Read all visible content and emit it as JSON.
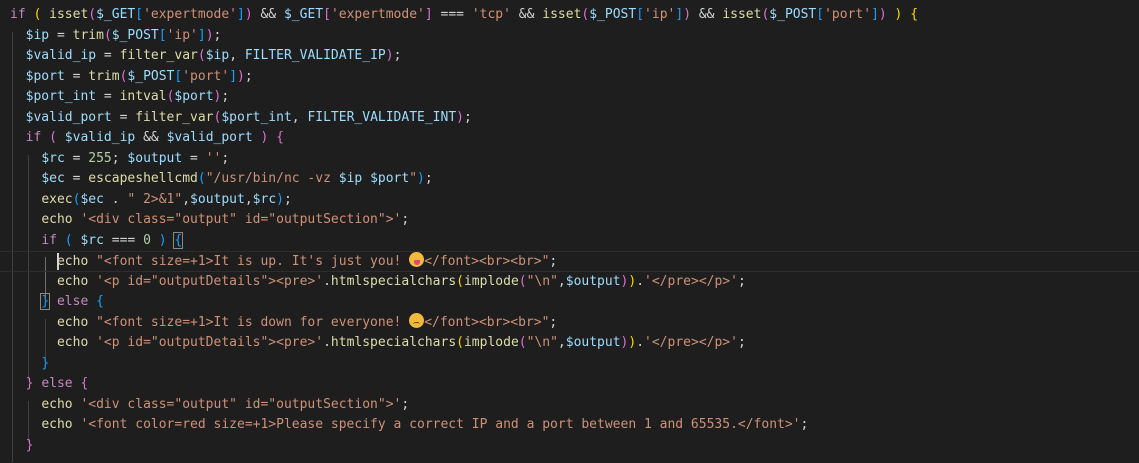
{
  "editor": {
    "language": "php",
    "theme": {
      "background": "#1e1e1e",
      "keyword": "#c586c0",
      "function": "#dcdcaa",
      "variable": "#9cdcfe",
      "string": "#ce9178",
      "number": "#b5cea8",
      "bracket_level1": "#ffd700",
      "bracket_level2": "#da70d6",
      "bracket_level3": "#179fff"
    },
    "current_line": 13,
    "lines": [
      [
        [
          "kw",
          "if"
        ],
        [
          "op",
          " "
        ],
        [
          "p1",
          "("
        ],
        [
          "op",
          " "
        ],
        [
          "fn",
          "isset"
        ],
        [
          "p2",
          "("
        ],
        [
          "var",
          "$_GET"
        ],
        [
          "p3",
          "["
        ],
        [
          "str",
          "'expertmode'"
        ],
        [
          "p3",
          "]"
        ],
        [
          "p2",
          ")"
        ],
        [
          "op",
          " && "
        ],
        [
          "var",
          "$_GET"
        ],
        [
          "p2",
          "["
        ],
        [
          "str",
          "'expertmode'"
        ],
        [
          "p2",
          "]"
        ],
        [
          "op",
          " === "
        ],
        [
          "str",
          "'tcp'"
        ],
        [
          "op",
          " && "
        ],
        [
          "fn",
          "isset"
        ],
        [
          "p2",
          "("
        ],
        [
          "var",
          "$_POST"
        ],
        [
          "p3",
          "["
        ],
        [
          "str",
          "'ip'"
        ],
        [
          "p3",
          "]"
        ],
        [
          "p2",
          ")"
        ],
        [
          "op",
          " && "
        ],
        [
          "fn",
          "isset"
        ],
        [
          "p2",
          "("
        ],
        [
          "var",
          "$_POST"
        ],
        [
          "p3",
          "["
        ],
        [
          "str",
          "'port'"
        ],
        [
          "p3",
          "]"
        ],
        [
          "p2",
          ")"
        ],
        [
          "op",
          " "
        ],
        [
          "p1",
          ")"
        ],
        [
          "op",
          " "
        ],
        [
          "p1",
          "{"
        ]
      ],
      [
        [
          "op",
          "  "
        ],
        [
          "var",
          "$ip"
        ],
        [
          "op",
          " = "
        ],
        [
          "fn",
          "trim"
        ],
        [
          "p2",
          "("
        ],
        [
          "var",
          "$_POST"
        ],
        [
          "p3",
          "["
        ],
        [
          "str",
          "'ip'"
        ],
        [
          "p3",
          "]"
        ],
        [
          "p2",
          ")"
        ],
        [
          "op",
          ";"
        ]
      ],
      [
        [
          "op",
          "  "
        ],
        [
          "var",
          "$valid_ip"
        ],
        [
          "op",
          " = "
        ],
        [
          "fn",
          "filter_var"
        ],
        [
          "p2",
          "("
        ],
        [
          "var",
          "$ip"
        ],
        [
          "op",
          ", "
        ],
        [
          "const",
          "FILTER_VALIDATE_IP"
        ],
        [
          "p2",
          ")"
        ],
        [
          "op",
          ";"
        ]
      ],
      [
        [
          "op",
          "  "
        ],
        [
          "var",
          "$port"
        ],
        [
          "op",
          " = "
        ],
        [
          "fn",
          "trim"
        ],
        [
          "p2",
          "("
        ],
        [
          "var",
          "$_POST"
        ],
        [
          "p3",
          "["
        ],
        [
          "str",
          "'port'"
        ],
        [
          "p3",
          "]"
        ],
        [
          "p2",
          ")"
        ],
        [
          "op",
          ";"
        ]
      ],
      [
        [
          "op",
          "  "
        ],
        [
          "var",
          "$port_int"
        ],
        [
          "op",
          " = "
        ],
        [
          "fn",
          "intval"
        ],
        [
          "p2",
          "("
        ],
        [
          "var",
          "$port"
        ],
        [
          "p2",
          ")"
        ],
        [
          "op",
          ";"
        ]
      ],
      [
        [
          "op",
          "  "
        ],
        [
          "var",
          "$valid_port"
        ],
        [
          "op",
          " = "
        ],
        [
          "fn",
          "filter_var"
        ],
        [
          "p2",
          "("
        ],
        [
          "var",
          "$port_int"
        ],
        [
          "op",
          ", "
        ],
        [
          "const",
          "FILTER_VALIDATE_INT"
        ],
        [
          "p2",
          ")"
        ],
        [
          "op",
          ";"
        ]
      ],
      [
        [
          "op",
          "  "
        ],
        [
          "kw",
          "if"
        ],
        [
          "op",
          " "
        ],
        [
          "p2",
          "("
        ],
        [
          "op",
          " "
        ],
        [
          "var",
          "$valid_ip"
        ],
        [
          "op",
          " && "
        ],
        [
          "var",
          "$valid_port"
        ],
        [
          "op",
          " "
        ],
        [
          "p2",
          ")"
        ],
        [
          "op",
          " "
        ],
        [
          "p2",
          "{"
        ]
      ],
      [
        [
          "op",
          "    "
        ],
        [
          "var",
          "$rc"
        ],
        [
          "op",
          " = "
        ],
        [
          "num",
          "255"
        ],
        [
          "op",
          "; "
        ],
        [
          "var",
          "$output"
        ],
        [
          "op",
          " = "
        ],
        [
          "str",
          "''"
        ],
        [
          "op",
          ";"
        ]
      ],
      [
        [
          "op",
          "    "
        ],
        [
          "var",
          "$ec"
        ],
        [
          "op",
          " = "
        ],
        [
          "fn",
          "escapeshellcmd"
        ],
        [
          "p3",
          "("
        ],
        [
          "str",
          "\"/usr/bin/nc -vz "
        ],
        [
          "var",
          "$ip"
        ],
        [
          "str",
          " "
        ],
        [
          "var",
          "$port"
        ],
        [
          "str",
          "\""
        ],
        [
          "p3",
          ")"
        ],
        [
          "op",
          ";"
        ]
      ],
      [
        [
          "op",
          "    "
        ],
        [
          "fn",
          "exec"
        ],
        [
          "p3",
          "("
        ],
        [
          "var",
          "$ec"
        ],
        [
          "op",
          " . "
        ],
        [
          "str",
          "\" 2>&1\""
        ],
        [
          "op",
          ","
        ],
        [
          "var",
          "$output"
        ],
        [
          "op",
          ","
        ],
        [
          "var",
          "$rc"
        ],
        [
          "p3",
          ")"
        ],
        [
          "op",
          ";"
        ]
      ],
      [
        [
          "op",
          "    "
        ],
        [
          "fn",
          "echo"
        ],
        [
          "op",
          " "
        ],
        [
          "str",
          "'<div class=\"output\" id=\"outputSection\">'"
        ],
        [
          "op",
          ";"
        ]
      ],
      [
        [
          "op",
          "    "
        ],
        [
          "kw",
          "if"
        ],
        [
          "op",
          " "
        ],
        [
          "p3",
          "("
        ],
        [
          "op",
          " "
        ],
        [
          "var",
          "$rc"
        ],
        [
          "op",
          " === "
        ],
        [
          "num",
          "0"
        ],
        [
          "op",
          " "
        ],
        [
          "p3",
          ")"
        ],
        [
          "op",
          " "
        ],
        [
          "p3m",
          "{"
        ]
      ],
      [
        [
          "op",
          "      "
        ],
        [
          "fn",
          "echo"
        ],
        [
          "op",
          " "
        ],
        [
          "str",
          "\"<font size=+1>It is up. It's just you! "
        ],
        [
          "emoji",
          "tongue"
        ],
        [
          "str",
          "</font><br><br>\""
        ],
        [
          "op",
          ";"
        ]
      ],
      [
        [
          "op",
          "      "
        ],
        [
          "fn",
          "echo"
        ],
        [
          "op",
          " "
        ],
        [
          "str",
          "'<p id=\"outputDetails\"><pre>'"
        ],
        [
          "op",
          "."
        ],
        [
          "fn",
          "htmlspecialchars"
        ],
        [
          "p1",
          "("
        ],
        [
          "fn",
          "implode"
        ],
        [
          "p2",
          "("
        ],
        [
          "str",
          "\"\\n\""
        ],
        [
          "op",
          ","
        ],
        [
          "var",
          "$output"
        ],
        [
          "p2",
          ")"
        ],
        [
          "p1",
          ")"
        ],
        [
          "op",
          "."
        ],
        [
          "str",
          "'</pre></p>'"
        ],
        [
          "op",
          ";"
        ]
      ],
      [
        [
          "op",
          "    "
        ],
        [
          "p3m",
          "}"
        ],
        [
          "op",
          " "
        ],
        [
          "kw",
          "else"
        ],
        [
          "op",
          " "
        ],
        [
          "p3",
          "{"
        ]
      ],
      [
        [
          "op",
          "      "
        ],
        [
          "fn",
          "echo"
        ],
        [
          "op",
          " "
        ],
        [
          "str",
          "\"<font size=+1>It is down for everyone! "
        ],
        [
          "emoji",
          "sad"
        ],
        [
          "str",
          "</font><br><br>\""
        ],
        [
          "op",
          ";"
        ]
      ],
      [
        [
          "op",
          "      "
        ],
        [
          "fn",
          "echo"
        ],
        [
          "op",
          " "
        ],
        [
          "str",
          "'<p id=\"outputDetails\"><pre>'"
        ],
        [
          "op",
          "."
        ],
        [
          "fn",
          "htmlspecialchars"
        ],
        [
          "p1",
          "("
        ],
        [
          "fn",
          "implode"
        ],
        [
          "p2",
          "("
        ],
        [
          "str",
          "\"\\n\""
        ],
        [
          "op",
          ","
        ],
        [
          "var",
          "$output"
        ],
        [
          "p2",
          ")"
        ],
        [
          "p1",
          ")"
        ],
        [
          "op",
          "."
        ],
        [
          "str",
          "'</pre></p>'"
        ],
        [
          "op",
          ";"
        ]
      ],
      [
        [
          "op",
          "    "
        ],
        [
          "p3",
          "}"
        ]
      ],
      [
        [
          "op",
          "  "
        ],
        [
          "p2",
          "}"
        ],
        [
          "op",
          " "
        ],
        [
          "kw",
          "else"
        ],
        [
          "op",
          " "
        ],
        [
          "p2",
          "{"
        ]
      ],
      [
        [
          "op",
          "    "
        ],
        [
          "fn",
          "echo"
        ],
        [
          "op",
          " "
        ],
        [
          "str",
          "'<div class=\"output\" id=\"outputSection\">'"
        ],
        [
          "op",
          ";"
        ]
      ],
      [
        [
          "op",
          "    "
        ],
        [
          "fn",
          "echo"
        ],
        [
          "op",
          " "
        ],
        [
          "str",
          "'<font color=red size=+1>Please specify a correct IP and a port between 1 and 65535.</font>'"
        ],
        [
          "op",
          ";"
        ]
      ],
      [
        [
          "op",
          "  "
        ],
        [
          "p2",
          "}"
        ]
      ]
    ]
  }
}
